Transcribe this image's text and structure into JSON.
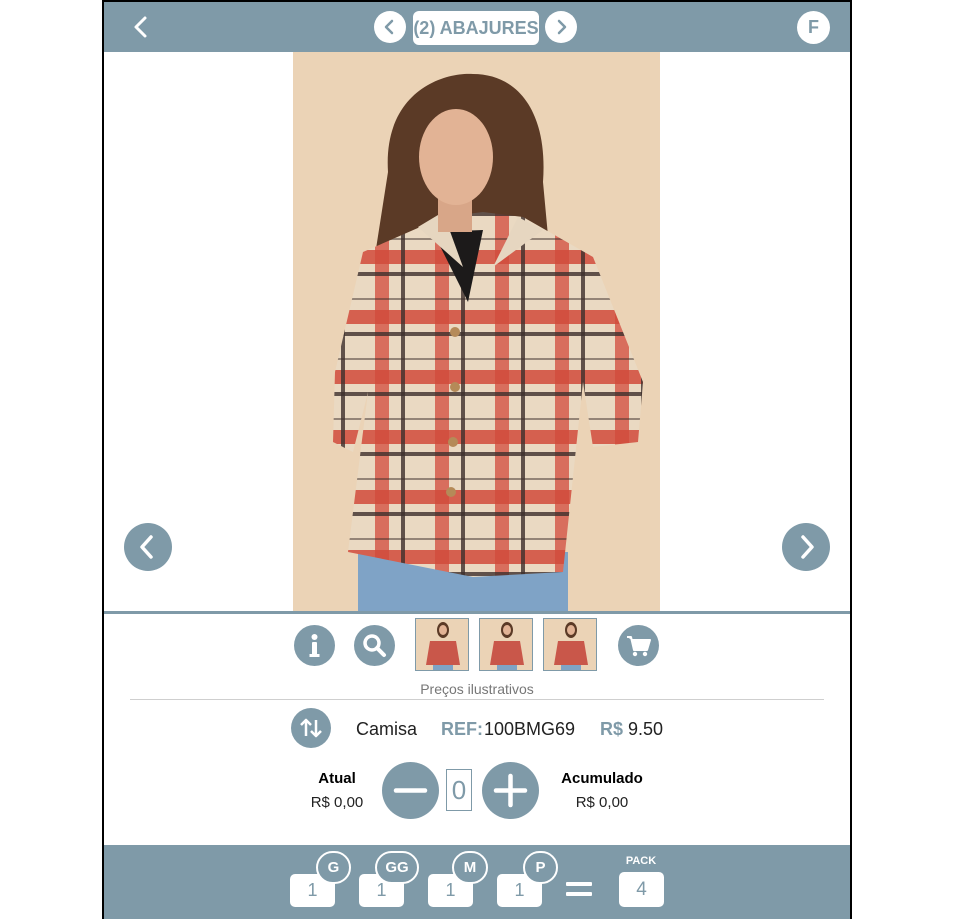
{
  "header": {
    "back_icon": "chevron-left-icon",
    "prev_icon": "chevron-left-icon",
    "next_icon": "chevron-right-icon",
    "category_title": "(2) ABAJURES",
    "user_initial": "F"
  },
  "colors": {
    "accent": "#7f9aa8",
    "background": "#ffffff",
    "text": "#222222"
  },
  "gallery": {
    "prev_icon": "chevron-left-icon",
    "next_icon": "chevron-right-icon",
    "main_image": "model-plaid-shirt-photo",
    "thumbnails": [
      "model-plaid-shirt-thumb-1",
      "model-plaid-shirt-thumb-2",
      "model-plaid-shirt-thumb-3"
    ]
  },
  "actions": {
    "info_icon": "info-icon",
    "search_icon": "search-icon",
    "cart_icon": "cart-icon",
    "note": "Preços ilustrativos"
  },
  "product": {
    "swap_icon": "swap-icon",
    "name": "Camisa",
    "ref_label": "REF:",
    "ref_value": "100BMG69",
    "price_label": "R$",
    "price_value": "9.50"
  },
  "quantity": {
    "current_label": "Atual",
    "current_value": "R$ 0,00",
    "accum_label": "Acumulado",
    "accum_value": "R$ 0,00",
    "minus_icon": "minus-icon",
    "plus_icon": "plus-icon",
    "value": "0"
  },
  "sizes": [
    {
      "label": "G",
      "qty": "1"
    },
    {
      "label": "GG",
      "qty": "1"
    },
    {
      "label": "M",
      "qty": "1"
    },
    {
      "label": "P",
      "qty": "1"
    }
  ],
  "pack": {
    "label": "PACK",
    "value": "4",
    "equals_icon": "equals-icon"
  }
}
